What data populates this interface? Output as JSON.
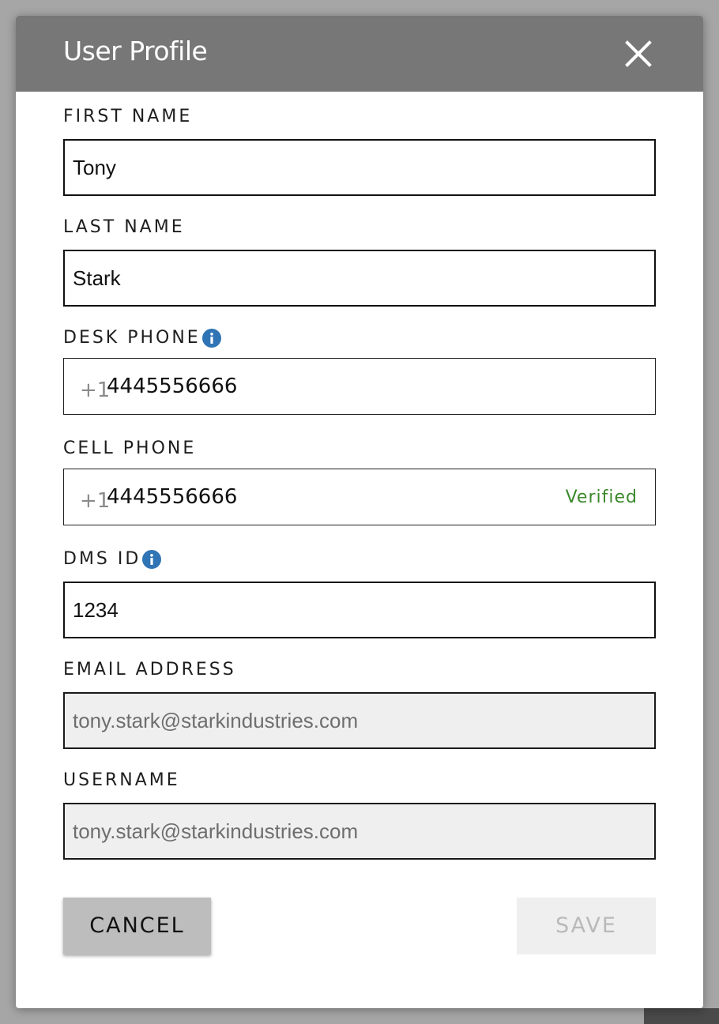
{
  "dialog": {
    "title": "User Profile"
  },
  "fields": {
    "first_name": {
      "label": "FIRST NAME",
      "value": "Tony"
    },
    "last_name": {
      "label": "LAST NAME",
      "value": "Stark"
    },
    "desk_phone": {
      "label": "DESK PHONE",
      "prefix": "+1",
      "value": "4445556666",
      "info_icon": "info-icon"
    },
    "cell_phone": {
      "label": "CELL PHONE",
      "prefix": "+1",
      "value": "4445556666",
      "status": "Verified",
      "status_color": "#3b8a2c"
    },
    "dms_id": {
      "label": "DMS ID",
      "value": "1234",
      "info_icon": "info-icon"
    },
    "email": {
      "label": "EMAIL ADDRESS",
      "value": "tony.stark@starkindustries.com",
      "disabled": true
    },
    "username": {
      "label": "USERNAME",
      "value": "tony.stark@starkindustries.com",
      "disabled": true
    }
  },
  "actions": {
    "cancel_label": "CANCEL",
    "save_label": "SAVE",
    "save_disabled": true
  },
  "colors": {
    "header_bg": "#777777",
    "info_icon": "#2f74b5",
    "verified": "#3b8a2c"
  }
}
